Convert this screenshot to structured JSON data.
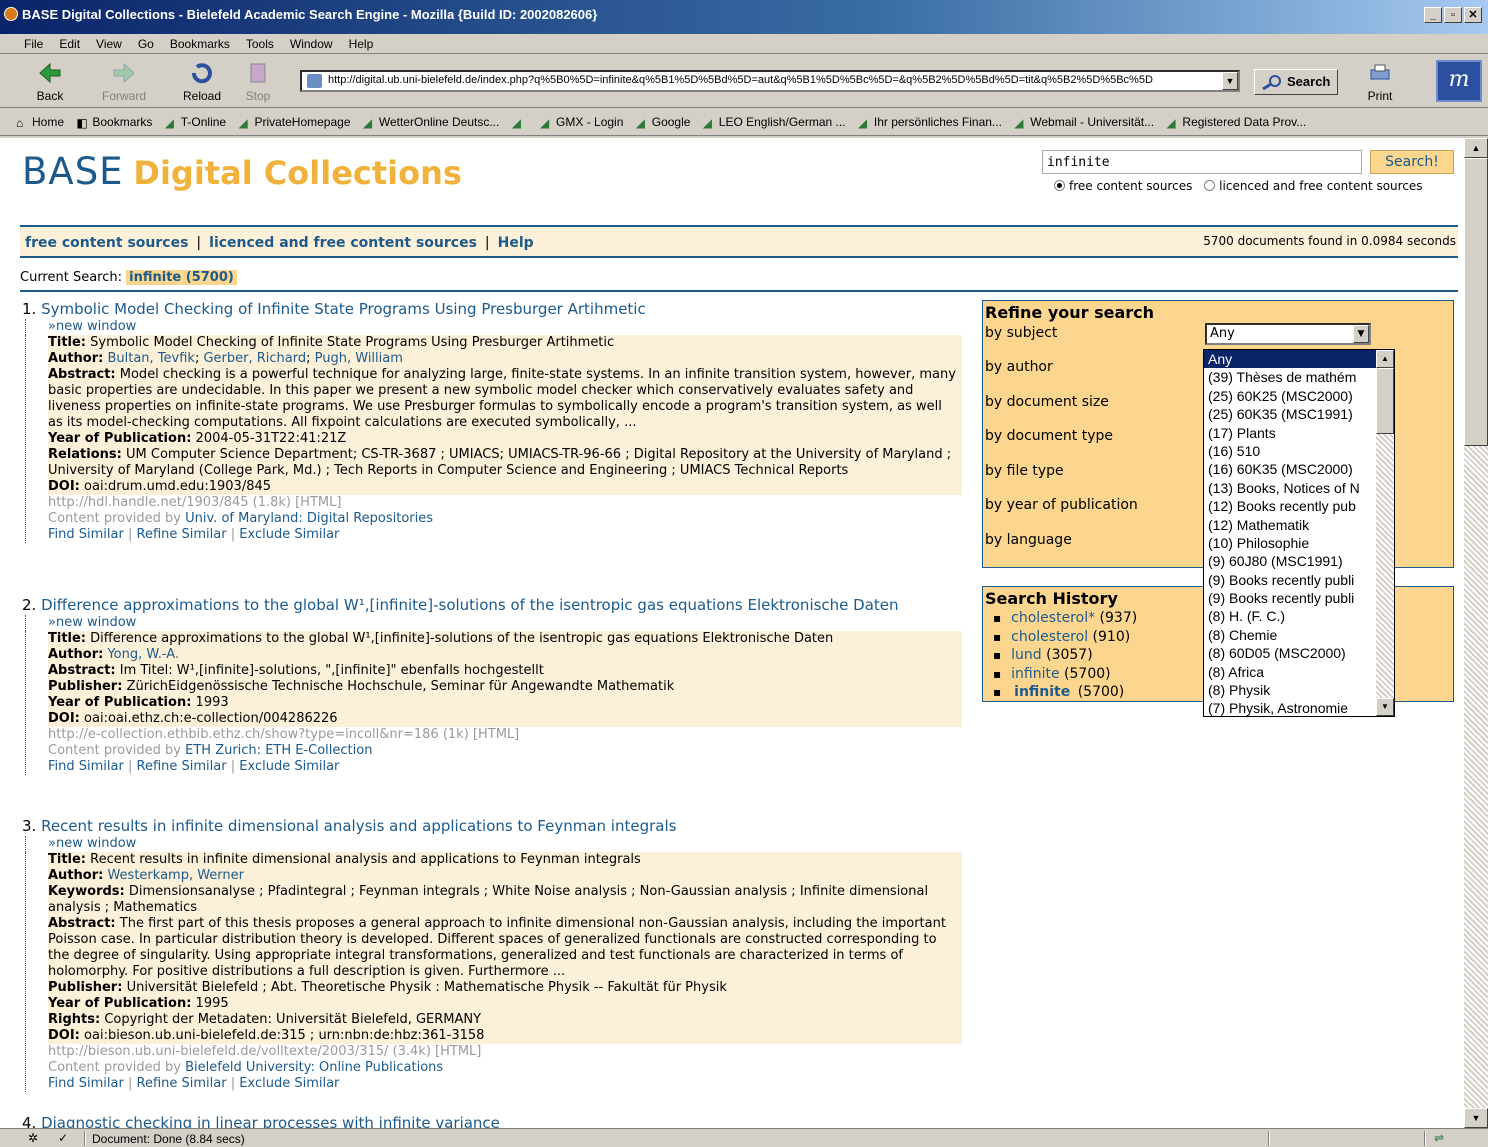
{
  "window": {
    "title": "BASE Digital Collections - Bielefeld Academic Search Engine - Mozilla {Build ID: 2002082606}"
  },
  "menu": [
    "File",
    "Edit",
    "View",
    "Go",
    "Bookmarks",
    "Tools",
    "Window",
    "Help"
  ],
  "toolbar": {
    "back": "Back",
    "forward": "Forward",
    "reload": "Reload",
    "stop": "Stop",
    "url": "http://digital.ub.uni-bielefeld.de/index.php?q%5B0%5D=infinite&q%5B1%5D%5Bd%5D=aut&q%5B1%5D%5Bc%5D=&q%5B2%5D%5Bd%5D=tit&q%5B2%5D%5Bc%5D",
    "search": "Search",
    "print": "Print"
  },
  "bookmarks": [
    "Home",
    "Bookmarks",
    "T-Online",
    "PrivateHomepage",
    "WetterOnline Deutsc...",
    "",
    "GMX - Login",
    "Google",
    "LEO English/German ...",
    "Ihr persönliches Finan...",
    "Webmail - Universität...",
    "Registered Data Prov..."
  ],
  "site": {
    "logo_base": "BASE",
    "logo_title": "Digital Collections",
    "query": "infinite",
    "search_button": "Search!",
    "radio_free": "free content sources",
    "radio_licensed": "licenced and free content sources",
    "nav_free": "free content sources",
    "nav_licensed": "licenced and free content sources",
    "nav_help": "Help",
    "found": "5700 documents found in 0.0984 seconds",
    "current_search_label": "Current Search:",
    "current_search_value": "infinite (5700)"
  },
  "results": [
    {
      "num": "1.",
      "title": "Symbolic Model Checking of Infinite State Programs Using Presburger Artihmetic",
      "new_window": "»new window",
      "fields": [
        {
          "label": "Title:",
          "value": "Symbolic Model Checking of Infinite State Programs Using Presburger Artihmetic"
        },
        {
          "label": "Author:",
          "links": [
            "Bultan, Tevfik",
            "Gerber, Richard",
            "Pugh, William"
          ]
        },
        {
          "label": "Abstract:",
          "value": "Model checking is a powerful technique for analyzing large, finite-state systems. In an infinite transition system, however, many basic properties are undecidable. In this paper we present a new symbolic model checker which conservatively evaluates safety and liveness properties on infinite-state programs. We use Presburger formulas to symbolically encode a program's transition system, as well as its model-checking computations. All fixpoint calculations are executed symbolically, ..."
        },
        {
          "label": "Year of Publication:",
          "value": "2004-05-31T22:41:21Z"
        },
        {
          "label": "Relations:",
          "value": "UM Computer Science Department; CS-TR-3687 ; UMIACS; UMIACS-TR-96-66 ; Digital Repository at the University of Maryland ; University of Maryland (College Park, Md.) ; Tech Reports in Computer Science and Engineering ; UMIACS Technical Reports"
        },
        {
          "label": "DOI:",
          "value": "oai:drum.umd.edu:1903/845"
        }
      ],
      "url": "http://hdl.handle.net/1903/845 (1.8k) [HTML]",
      "provider_label": "Content provided by",
      "provider": "Univ. of Maryland: Digital Repositories"
    },
    {
      "num": "2.",
      "title": "Difference approximations to the global W¹,[infinite]-solutions of the isentropic gas equations Elektronische Daten",
      "new_window": "»new window",
      "fields": [
        {
          "label": "Title:",
          "value": "Difference approximations to the global W¹,[infinite]-solutions of the isentropic gas equations Elektronische Daten"
        },
        {
          "label": "Author:",
          "links": [
            "Yong, W.-A."
          ]
        },
        {
          "label": "Abstract:",
          "value": "Im Titel: W¹,[infinite]-solutions, \",[infinite]\" ebenfalls hochgestellt"
        },
        {
          "label": "Publisher:",
          "value": "ZürichEidgenössische Technische Hochschule, Seminar für Angewandte Mathematik"
        },
        {
          "label": "Year of Publication:",
          "value": "1993"
        },
        {
          "label": "DOI:",
          "value": "oai:oai.ethz.ch:e-collection/004286226"
        }
      ],
      "url": "http://e-collection.ethbib.ethz.ch/show?type=incoll&nr=186 (1k) [HTML]",
      "provider_label": "Content provided by",
      "provider": "ETH Zurich: ETH E-Collection"
    },
    {
      "num": "3.",
      "title": "Recent results in infinite dimensional analysis and applications to Feynman integrals",
      "new_window": "»new window",
      "fields": [
        {
          "label": "Title:",
          "value": "Recent results in infinite dimensional analysis and applications to Feynman integrals"
        },
        {
          "label": "Author:",
          "links": [
            "Westerkamp, Werner"
          ]
        },
        {
          "label": "Keywords:",
          "value": "Dimensionsanalyse ; Pfadintegral ; Feynman integrals ; White Noise analysis ; Non-Gaussian analysis ; Infinite dimensional analysis ; Mathematics"
        },
        {
          "label": "Abstract:",
          "value": "The first part of this thesis proposes a general approach to infinite dimensional non-Gaussian analysis, including the important Poisson case. In particular distribution theory is developed. Different spaces of generalized functionals are constructed corresponding to the degree of singularity. Using appropriate integral transformations, generalized and test functionals are characterized in terms of holomorphy. For positive distributions a full description is given. Furthermore ..."
        },
        {
          "label": "Publisher:",
          "value": "Universität Bielefeld ; Abt. Theoretische Physik : Mathematische Physik -- Fakultät für Physik"
        },
        {
          "label": "Year of Publication:",
          "value": "1995"
        },
        {
          "label": "Rights:",
          "value": "Copyright der Metadaten: Universität Bielefeld, GERMANY"
        },
        {
          "label": "DOI:",
          "value": "oai:bieson.ub.uni-bielefeld.de:315 ; urn:nbn:de:hbz:361-3158"
        }
      ],
      "url": "http://bieson.ub.uni-bielefeld.de/volltexte/2003/315/ (3.4k) [HTML]",
      "provider_label": "Content provided by",
      "provider": "Bielefeld University: Online Publications"
    },
    {
      "num": "4.",
      "title": "Diagnostic checking in linear processes with infinite variance"
    }
  ],
  "similar": {
    "find": "Find Similar",
    "refine": "Refine Similar",
    "exclude": "Exclude Similar",
    "sep": "|"
  },
  "refine": {
    "heading": "Refine your search",
    "rows": [
      "by subject",
      "by author",
      "by document size",
      "by document type",
      "by file type",
      "by year of publication",
      "by language"
    ],
    "selected": "Any",
    "options": [
      "Any",
      "(39) Thèses de mathém",
      "(25) 60K25 (MSC2000)",
      "(25) 60K35 (MSC1991)",
      "(17) Plants",
      "(16) 510",
      "(16) 60K35 (MSC2000)",
      "(13) Books, Notices of N",
      "(12) Books recently pub",
      "(12) Mathematik",
      "(10) Philosophie",
      "(9) 60J80 (MSC1991)",
      "(9) Books recently publi",
      "(9) Books recently publi",
      "(8) H. (F. C.)",
      "(8) Chemie",
      "(8) 60D05 (MSC2000)",
      "(8) Africa",
      "(8) Physik",
      "(7) Physik, Astronomie"
    ]
  },
  "history": {
    "heading": "Search History",
    "items": [
      {
        "term": "cholesterol*",
        "count": "(937)"
      },
      {
        "term": "cholesterol",
        "count": "(910)"
      },
      {
        "term": "lund",
        "count": "(3057)"
      },
      {
        "term": "infinite",
        "count": "(5700)"
      },
      {
        "term": "infinite",
        "count": "(5700)",
        "current": true
      }
    ]
  },
  "statusbar": {
    "text": "Document: Done (8.84 secs)"
  }
}
